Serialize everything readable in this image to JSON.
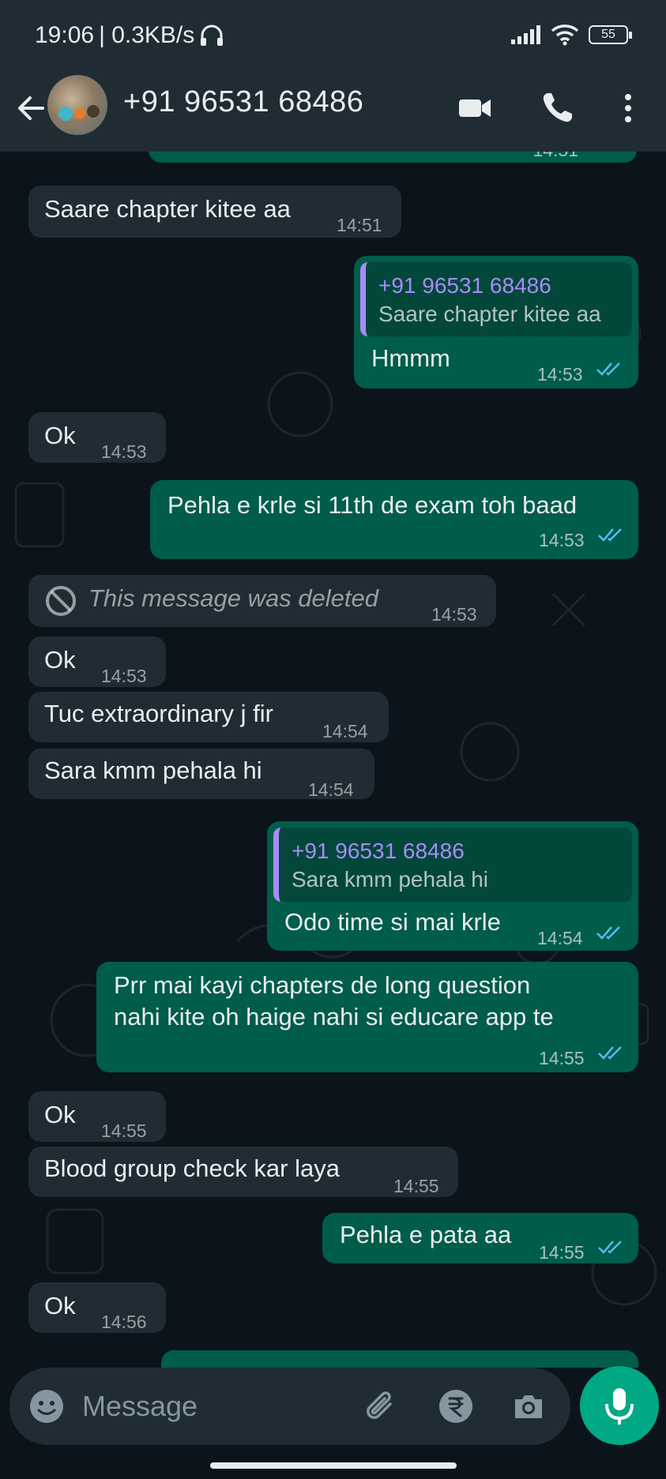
{
  "status_bar": {
    "time": "19:06",
    "speed": "| 0.3KB/s",
    "battery": "55"
  },
  "header": {
    "contact_name": "+91 96531 68486"
  },
  "messages": [
    {
      "dir": "in",
      "text": "Saare chapter kitee aa",
      "time": "14:51"
    },
    {
      "dir": "out",
      "quote_name": "+91 96531 68486",
      "quote_text": "Saare chapter kitee aa",
      "text": "Hmmm",
      "time": "14:53"
    },
    {
      "dir": "in",
      "text": "Ok",
      "time": "14:53"
    },
    {
      "dir": "out",
      "text": "Pehla e krle si 11th de exam toh baad",
      "time": "14:53"
    },
    {
      "dir": "in",
      "text": "This message was deleted",
      "time": "14:53",
      "deleted": true
    },
    {
      "dir": "in",
      "text": "Ok",
      "time": "14:53"
    },
    {
      "dir": "in",
      "text": "Tuc extraordinary j fir",
      "time": "14:54"
    },
    {
      "dir": "in",
      "text": "Sara kmm pehala hi",
      "time": "14:54"
    },
    {
      "dir": "out",
      "quote_name": "+91 96531 68486",
      "quote_text": "Sara kmm pehala hi",
      "text": "Odo time si mai krle",
      "time": "14:54"
    },
    {
      "dir": "out",
      "text_line1": "Prr mai kayi chapters de long question",
      "text_line2": "nahi kite oh haige nahi si educare app te",
      "time": "14:55"
    },
    {
      "dir": "in",
      "text": "Ok",
      "time": "14:55"
    },
    {
      "dir": "in",
      "text": "Blood group check kar laya",
      "time": "14:55"
    },
    {
      "dir": "out",
      "text": "Pehla e pata aa",
      "time": "14:55"
    },
    {
      "dir": "in",
      "text": "Ok",
      "time": "14:56"
    }
  ],
  "partial_top_time": "14:51",
  "input": {
    "placeholder": "Message"
  },
  "colors": {
    "incoming": "#1f2c34",
    "outgoing": "#005c4b",
    "quote_accent": "#a78bfa",
    "read_ticks": "#53bdeb",
    "mic_button": "#00a884"
  }
}
